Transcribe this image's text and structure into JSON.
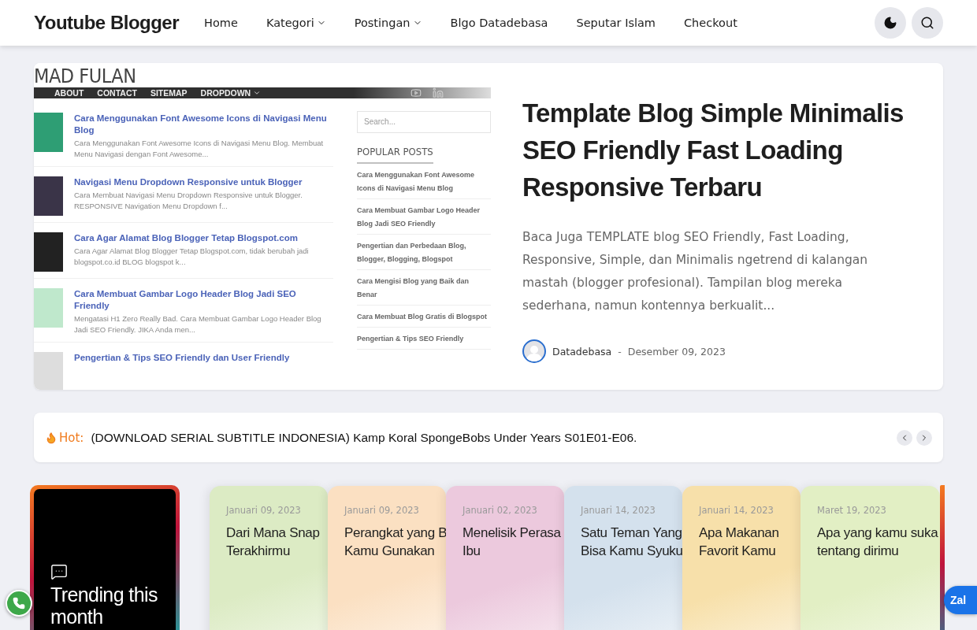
{
  "header": {
    "logo": "Youtube Blogger",
    "nav": [
      {
        "label": "Home",
        "dropdown": false
      },
      {
        "label": "Kategori",
        "dropdown": true
      },
      {
        "label": "Postingan",
        "dropdown": true
      },
      {
        "label": "Blgo Datadebasa",
        "dropdown": false
      },
      {
        "label": "Seputar Islam",
        "dropdown": false
      },
      {
        "label": "Checkout",
        "dropdown": false
      }
    ]
  },
  "featured": {
    "image": {
      "site_title": "MAD FULAN",
      "menu": [
        "ABOUT",
        "CONTACT",
        "SITEMAP",
        "DROPDOWN"
      ],
      "posts": [
        {
          "title": "Cara Menggunakan Font Awesome Icons di Navigasi Menu Blog",
          "snippet": "Cara Menggunakan Font Awesome Icons di Navigasi Menu Blog. Membuat Menu Navigasi dengan Font Awesome...",
          "color": "#2e9e74"
        },
        {
          "title": "Navigasi Menu Dropdown Responsive untuk Blogger",
          "snippet": "Cara Membuat Navigasi Menu Dropdown Responsive untuk Blogger. RESPONSIVE Navigation Menu Dropdown f...",
          "color": "#3a3448"
        },
        {
          "title": "Cara Agar Alamat Blog Blogger Tetap Blogspot.com",
          "snippet": "Cara Agar Alamat Blog Blogger Tetap Blogspot.com, tidak berubah jadi blogspot.co.id BLOG blogspot k...",
          "color": "#222222"
        },
        {
          "title": "Cara Membuat Gambar Logo Header Blog Jadi SEO Friendly",
          "snippet": "Mengatasi H1 Zero Really Bad. Cara Membuat Gambar Logo Header Blog Jadi SEO Friendly. JIKA Anda men...",
          "color": "#bfe8cc"
        },
        {
          "title": "Pengertian & Tips SEO Friendly dan User Friendly",
          "color": "#dddddd"
        }
      ],
      "search_placeholder": "Search...",
      "popular_heading": "POPULAR POSTS",
      "popular": [
        "Cara Menggunakan Font Awesome Icons di Navigasi Menu Blog",
        "Cara Membuat Gambar Logo Header Blog Jadi SEO Friendly",
        "Pengertian dan Perbedaan Blog, Blogger, Blogging, Blogspot",
        "Cara Mengisi Blog yang Baik dan Benar",
        "Cara Membuat Blog Gratis di Blogspot",
        "Pengertian & Tips SEO Friendly"
      ]
    },
    "title": "Template Blog Simple Minimalis SEO Friendly Fast Loading Responsive Terbaru",
    "excerpt": "Baca Juga TEMPLATE blog SEO Friendly, Fast Loading, Responsive, Simple, dan Minimalis ngetrend di kalangan mastah (blogger profesional). Tampilan blog mereka sederhana, namun kontennya berkualit...",
    "author": "Datadebasa",
    "separator": "-",
    "date": "Desember 09, 2023"
  },
  "ticker": {
    "label": "Hot:",
    "text": "(DOWNLOAD SERIAL SUBTITLE INDONESIA) Kamp Koral SpongeBobs Under Years S01E01-E06."
  },
  "trending": {
    "title": "Trending this month"
  },
  "cards": [
    {
      "date": "Januari 09, 2023",
      "title_lines": [
        "Dari Mana Snap",
        "Terakhirmu"
      ],
      "color": "#dcebc4"
    },
    {
      "date": "Januari 09, 2023",
      "title_lines": [
        "Perangkat yang B",
        "Kamu Gunakan"
      ],
      "color": "#fbe0c2"
    },
    {
      "date": "Januari 02, 2023",
      "title_lines": [
        "Menelisik Perasa",
        "Ibu"
      ],
      "color": "#ecc9dd"
    },
    {
      "date": "Januari 14, 2023",
      "title_lines": [
        "Satu Teman Yang",
        "Bisa Kamu Syuku"
      ],
      "color": "#d4e1ed"
    },
    {
      "date": "Januari 14, 2023",
      "title_lines": [
        "Apa Makanan",
        "Favorit Kamu"
      ],
      "color": "#f7e0aa"
    },
    {
      "date": "Maret 19, 2023",
      "title_lines": [
        "Apa yang kamu suka",
        "tentang dirimu"
      ],
      "color": "#e2efc4"
    }
  ],
  "floating": {
    "chat_label": "Zal"
  }
}
